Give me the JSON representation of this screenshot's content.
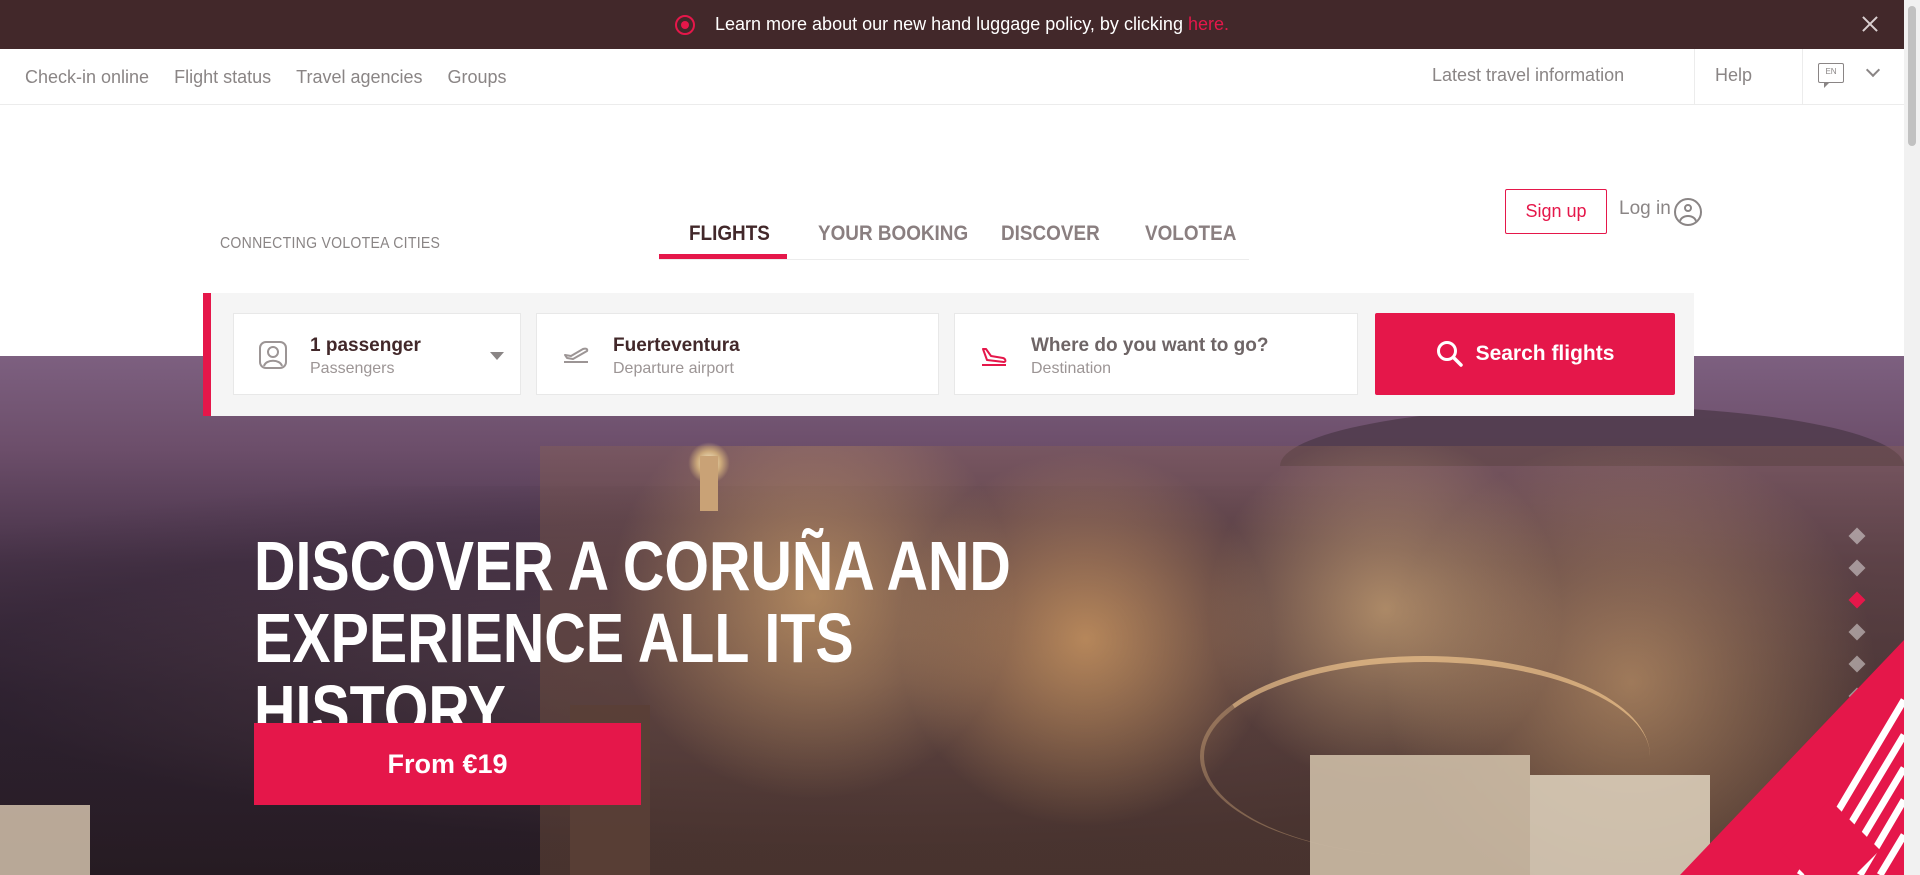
{
  "announcement": {
    "text": "Learn more about our new hand luggage policy, by clicking",
    "link_label": "here."
  },
  "topnav": {
    "items": [
      "Check-in online",
      "Flight status",
      "Travel agencies",
      "Groups"
    ],
    "latest_info": "Latest travel information",
    "help": "Help",
    "language": "EN"
  },
  "brand": {
    "tagline": "CONNECTING VOLOTEA CITIES"
  },
  "tabs": [
    {
      "label": "FLIGHTS",
      "active": true
    },
    {
      "label": "YOUR BOOKING",
      "active": false
    },
    {
      "label": "DISCOVER",
      "active": false
    },
    {
      "label": "VOLOTEA",
      "active": false
    }
  ],
  "account": {
    "signup": "Sign up",
    "login": "Log in"
  },
  "search": {
    "passengers": {
      "value": "1 passenger",
      "label": "Passengers",
      "icon": "passenger-icon"
    },
    "departure": {
      "value": "Fuerteventura",
      "label": "Departure airport",
      "icon": "takeoff-icon"
    },
    "destination": {
      "value": "Where do you want to go?",
      "label": "Destination",
      "icon": "landing-icon"
    },
    "button": "Search flights"
  },
  "hero": {
    "headline_line1": "DISCOVER A CORUÑA AND",
    "headline_line2": "EXPERIENCE ALL ITS HISTORY.",
    "cta": "From €19",
    "slides": 6,
    "active_slide": 3
  },
  "colors": {
    "brand": "#e5174a",
    "dark": "#42282a",
    "muted": "#8a8585"
  }
}
